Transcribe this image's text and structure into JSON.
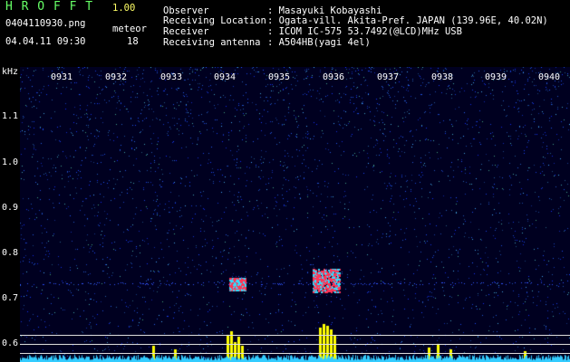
{
  "header": {
    "app_name": "H R O F F T",
    "version": "1.00",
    "filename": "0404110930.png",
    "datetime": "04.04.11 09:30",
    "counter_label": "meteor",
    "counter_value": "18",
    "info": [
      {
        "label": "Observer",
        "value": ": Masayuki Kobayashi"
      },
      {
        "label": "Receiving Location",
        "value": ": Ogata-vill. Akita-Pref. JAPAN (139.96E, 40.02N)"
      },
      {
        "label": "Receiver",
        "value": ": ICOM IC-575 53.7492(@LCD)MHz USB"
      },
      {
        "label": "Receiving antenna",
        "value": ": A504HB(yagi 4el)"
      }
    ]
  },
  "axis": {
    "unit": "kHz",
    "y_ticks": [
      "1.1",
      "1.0",
      "0.9",
      "0.8",
      "0.7",
      "0.6"
    ],
    "x_ticks": [
      "0931",
      "0932",
      "0933",
      "0934",
      "0935",
      "0936",
      "0937",
      "0938",
      "0939",
      "0940"
    ]
  },
  "colors": {
    "background": "#000000",
    "title_green": "#66ff66",
    "noise_blue": "#3344ff",
    "echo_red": "#ff3355",
    "bars_yellow": "#ffff00",
    "baseline_cyan": "#33ccff"
  }
}
